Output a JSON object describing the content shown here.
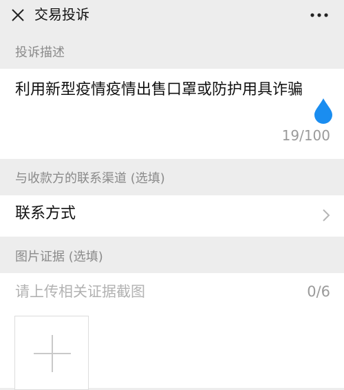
{
  "header": {
    "title": "交易投诉",
    "close_icon": "close-icon",
    "more_icon": "more-icon"
  },
  "description": {
    "section_label": "投诉描述",
    "text": "利用新型疫情疫情出售口罩或防护用具诈骗",
    "counter": "19/100"
  },
  "contact": {
    "section_label": "与收款方的联系渠道 (选填)",
    "row_label": "联系方式",
    "chevron_icon": "chevron-right-icon"
  },
  "evidence": {
    "section_label": "图片证据 (选填)",
    "placeholder": "请上传相关证据截图",
    "count": "0/6",
    "add_icon": "plus-icon"
  },
  "colors": {
    "background": "#ededed",
    "panel": "#ffffff",
    "secondary_text": "#8a8a8a",
    "cursor_handle": "#1a8df0"
  }
}
